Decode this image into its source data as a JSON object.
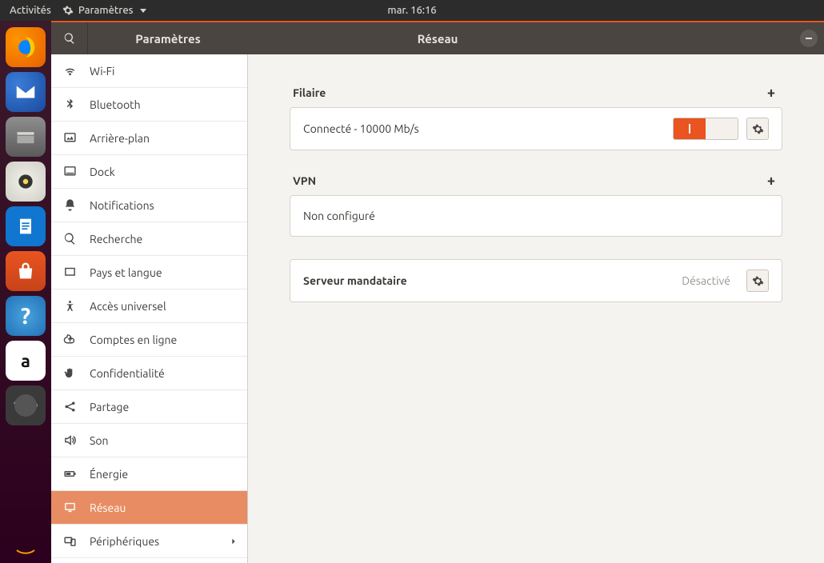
{
  "topbar": {
    "activities": "Activités",
    "app_menu": "Paramètres",
    "clock": "mar. 16:16"
  },
  "window": {
    "left_title": "Paramètres",
    "center_title": "Réseau"
  },
  "sidebar": [
    {
      "id": "wifi",
      "label": "Wi-Fi"
    },
    {
      "id": "bluetooth",
      "label": "Bluetooth"
    },
    {
      "id": "background",
      "label": "Arrière-plan"
    },
    {
      "id": "dock",
      "label": "Dock"
    },
    {
      "id": "notifications",
      "label": "Notifications"
    },
    {
      "id": "search",
      "label": "Recherche"
    },
    {
      "id": "region",
      "label": "Pays et langue"
    },
    {
      "id": "a11y",
      "label": "Accès universel"
    },
    {
      "id": "online",
      "label": "Comptes en ligne"
    },
    {
      "id": "privacy",
      "label": "Confidentialité"
    },
    {
      "id": "sharing",
      "label": "Partage"
    },
    {
      "id": "sound",
      "label": "Son"
    },
    {
      "id": "power",
      "label": "Énergie"
    },
    {
      "id": "network",
      "label": "Réseau"
    },
    {
      "id": "devices",
      "label": "Périphériques"
    }
  ],
  "network": {
    "wired_title": "Filaire",
    "wired_status": "Connecté - 10000 Mb/s",
    "vpn_title": "VPN",
    "vpn_status": "Non configuré",
    "proxy_title": "Serveur mandataire",
    "proxy_status": "Désactivé"
  }
}
